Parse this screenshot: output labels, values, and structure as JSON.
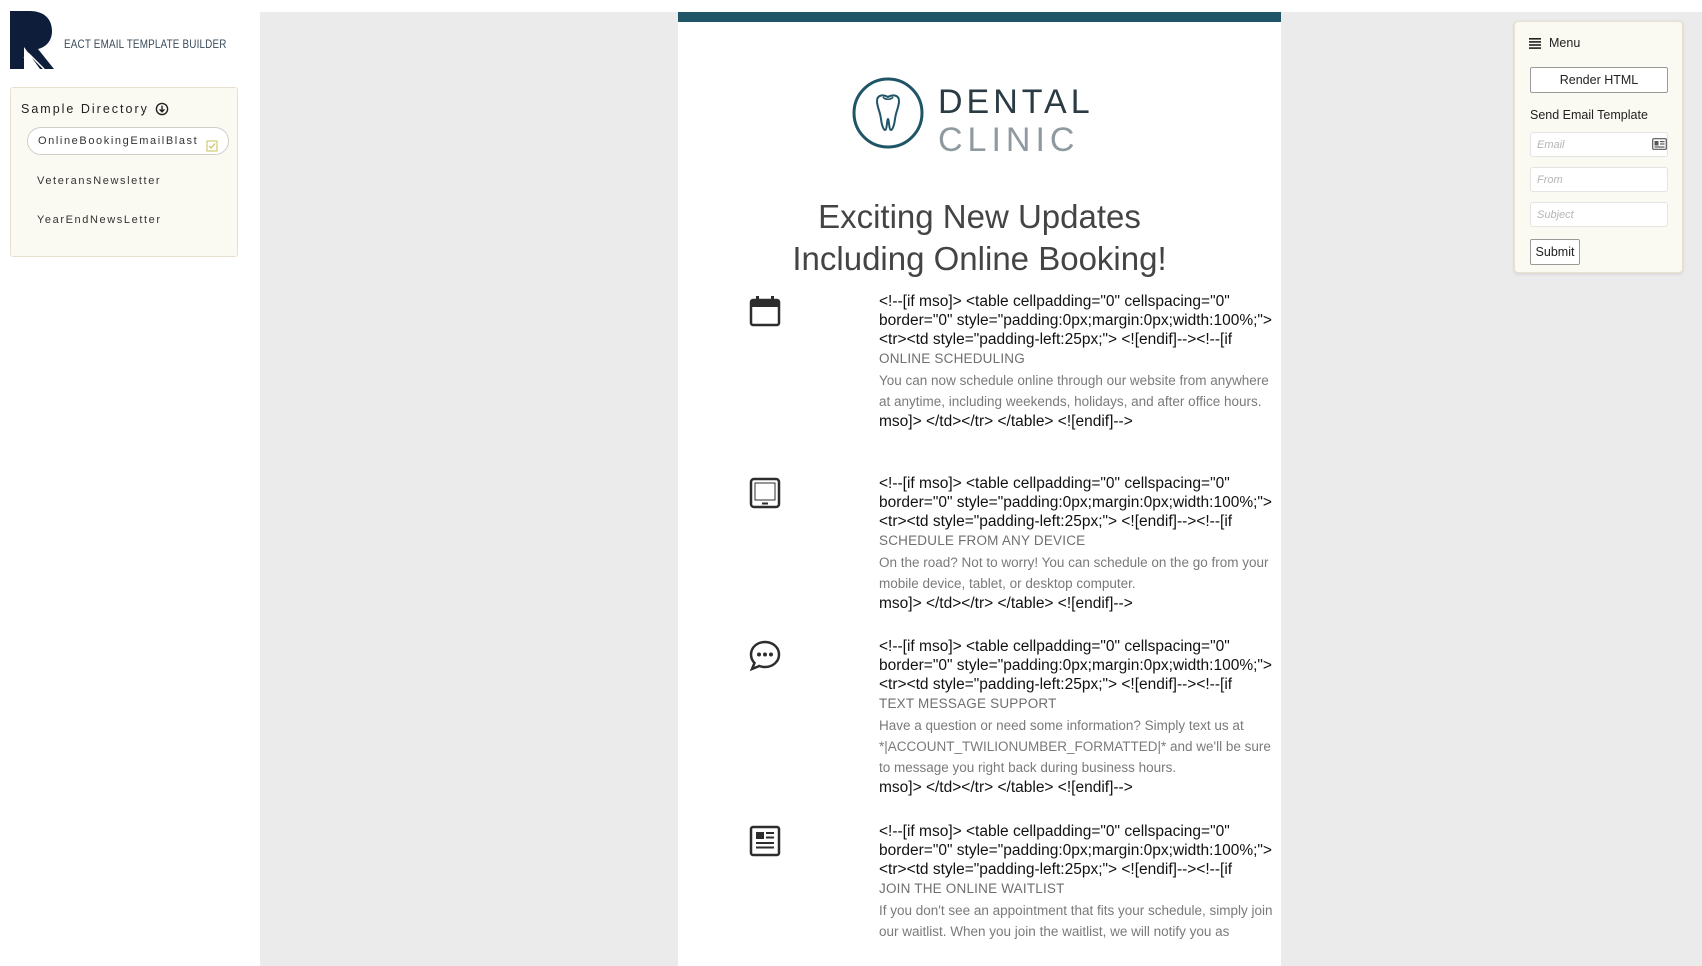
{
  "app": {
    "logo_letter": "R",
    "logo_text": "EACT EMAIL TEMPLATE BUILDER"
  },
  "sidebar": {
    "title": "Sample Directory",
    "items": [
      {
        "label": "OnlineBookingEmailBlast",
        "active": true
      },
      {
        "label": "VeteransNewsletter",
        "active": false
      },
      {
        "label": "YearEndNewsLetter",
        "active": false
      }
    ]
  },
  "email": {
    "accent_color": "#1f5566",
    "logo": {
      "line1": "DENTAL",
      "line2": "CLINIC"
    },
    "headline": [
      "Exciting New Updates",
      "Including Online Booking!"
    ],
    "features": [
      {
        "icon": "calendar-icon",
        "code_open": "<!--[if mso]> <table cellpadding=\"0\" cellspacing=\"0\" border=\"0\" style=\"padding:0px;margin:0px;width:100%;\"> <tr><td style=\"padding-left:25px;\"> <![endif]--><!--[if",
        "title": "ONLINE SCHEDULING",
        "description": "You can now schedule online through our website from anywhere at anytime, including weekends, holidays, and after office hours.",
        "code_close": "mso]> </td></tr> </table> <![endif]-->"
      },
      {
        "icon": "tablet-icon",
        "code_open": "<!--[if mso]> <table cellpadding=\"0\" cellspacing=\"0\" border=\"0\" style=\"padding:0px;margin:0px;width:100%;\"> <tr><td style=\"padding-left:25px;\"> <![endif]--><!--[if",
        "title": "SCHEDULE FROM ANY DEVICE",
        "description": "On the road? Not to worry! You can schedule on the go from your mobile device, tablet, or desktop computer.",
        "code_close": "mso]> </td></tr> </table> <![endif]-->"
      },
      {
        "icon": "chat-bubble-icon",
        "code_open": "<!--[if mso]> <table cellpadding=\"0\" cellspacing=\"0\" border=\"0\" style=\"padding:0px;margin:0px;width:100%;\"> <tr><td style=\"padding-left:25px;\"> <![endif]--><!--[if",
        "title": "TEXT MESSAGE SUPPORT",
        "description": "Have a question or need some information? Simply text us at *|ACCOUNT_TWILIONUMBER_FORMATTED|* and we'll be sure to message you right back during business hours.",
        "code_close": "mso]> </td></tr> </table> <![endif]-->"
      },
      {
        "icon": "list-document-icon",
        "code_open": "<!--[if mso]> <table cellpadding=\"0\" cellspacing=\"0\" border=\"0\" style=\"padding:0px;margin:0px;width:100%;\"> <tr><td style=\"padding-left:25px;\"> <![endif]--><!--[if",
        "title": "JOIN THE ONLINE WAITLIST",
        "description": "If you don't see an appointment that fits your schedule, simply join our waitlist. When you join the waitlist, we will notify you as",
        "code_close": ""
      }
    ]
  },
  "menu": {
    "title": "Menu",
    "render_label": "Render HTML",
    "send_label": "Send Email Template",
    "email_placeholder": "Email",
    "from_placeholder": "From",
    "subject_placeholder": "Subject",
    "submit_label": "Submit"
  }
}
